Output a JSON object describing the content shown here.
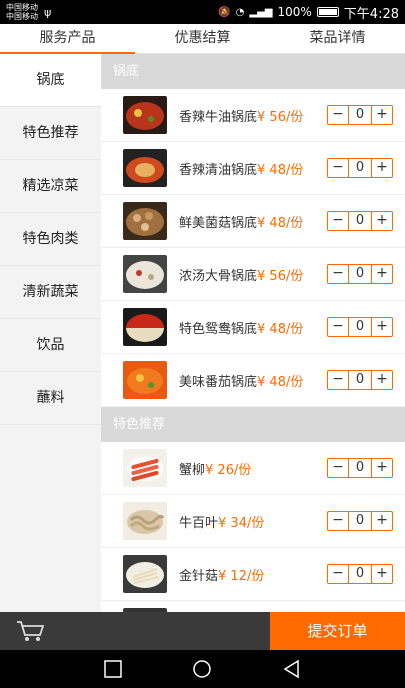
{
  "status_bar": {
    "carrier1": "中国移动",
    "carrier2": "中国移动",
    "battery": "100%",
    "time": "下午4:28"
  },
  "tabs": [
    {
      "label": "服务产品",
      "active": true
    },
    {
      "label": "优惠结算",
      "active": false
    },
    {
      "label": "菜品详情",
      "active": false
    }
  ],
  "sidebar": [
    {
      "label": "锅底",
      "active": true
    },
    {
      "label": "特色推荐"
    },
    {
      "label": "精选凉菜"
    },
    {
      "label": "特色肉类"
    },
    {
      "label": "清新蔬菜"
    },
    {
      "label": "饮品"
    },
    {
      "label": "蘸料"
    }
  ],
  "sections": [
    {
      "title": "锅底",
      "items": [
        {
          "name": "香辣牛油锅底",
          "price": "¥ 56/份",
          "qty": "0"
        },
        {
          "name": "香辣清油锅底",
          "price": "¥ 48/份",
          "qty": "0"
        },
        {
          "name": "鲜美菌菇锅底",
          "price": "¥ 48/份",
          "qty": "0"
        },
        {
          "name": "浓汤大骨锅底",
          "price": "¥ 56/份",
          "qty": "0"
        },
        {
          "name": "特色鸳鸯锅底",
          "price": "¥ 48/份",
          "qty": "0"
        },
        {
          "name": "美味番茄锅底",
          "price": "¥ 48/份",
          "qty": "0"
        }
      ]
    },
    {
      "title": "特色推荐",
      "items": [
        {
          "name": "蟹柳",
          "price": "¥ 26/份",
          "qty": "0"
        },
        {
          "name": "牛百叶",
          "price": "¥ 34/份",
          "qty": "0"
        },
        {
          "name": "金针菇",
          "price": "¥ 12/份",
          "qty": "0"
        }
      ]
    }
  ],
  "stepper": {
    "minus": "−",
    "plus": "+"
  },
  "bottom": {
    "submit_label": "提交订单"
  },
  "colors": {
    "accent": "#ff6a00",
    "section_bg": "#d9d9d9",
    "bottom_bar": "#3a3a3a"
  }
}
